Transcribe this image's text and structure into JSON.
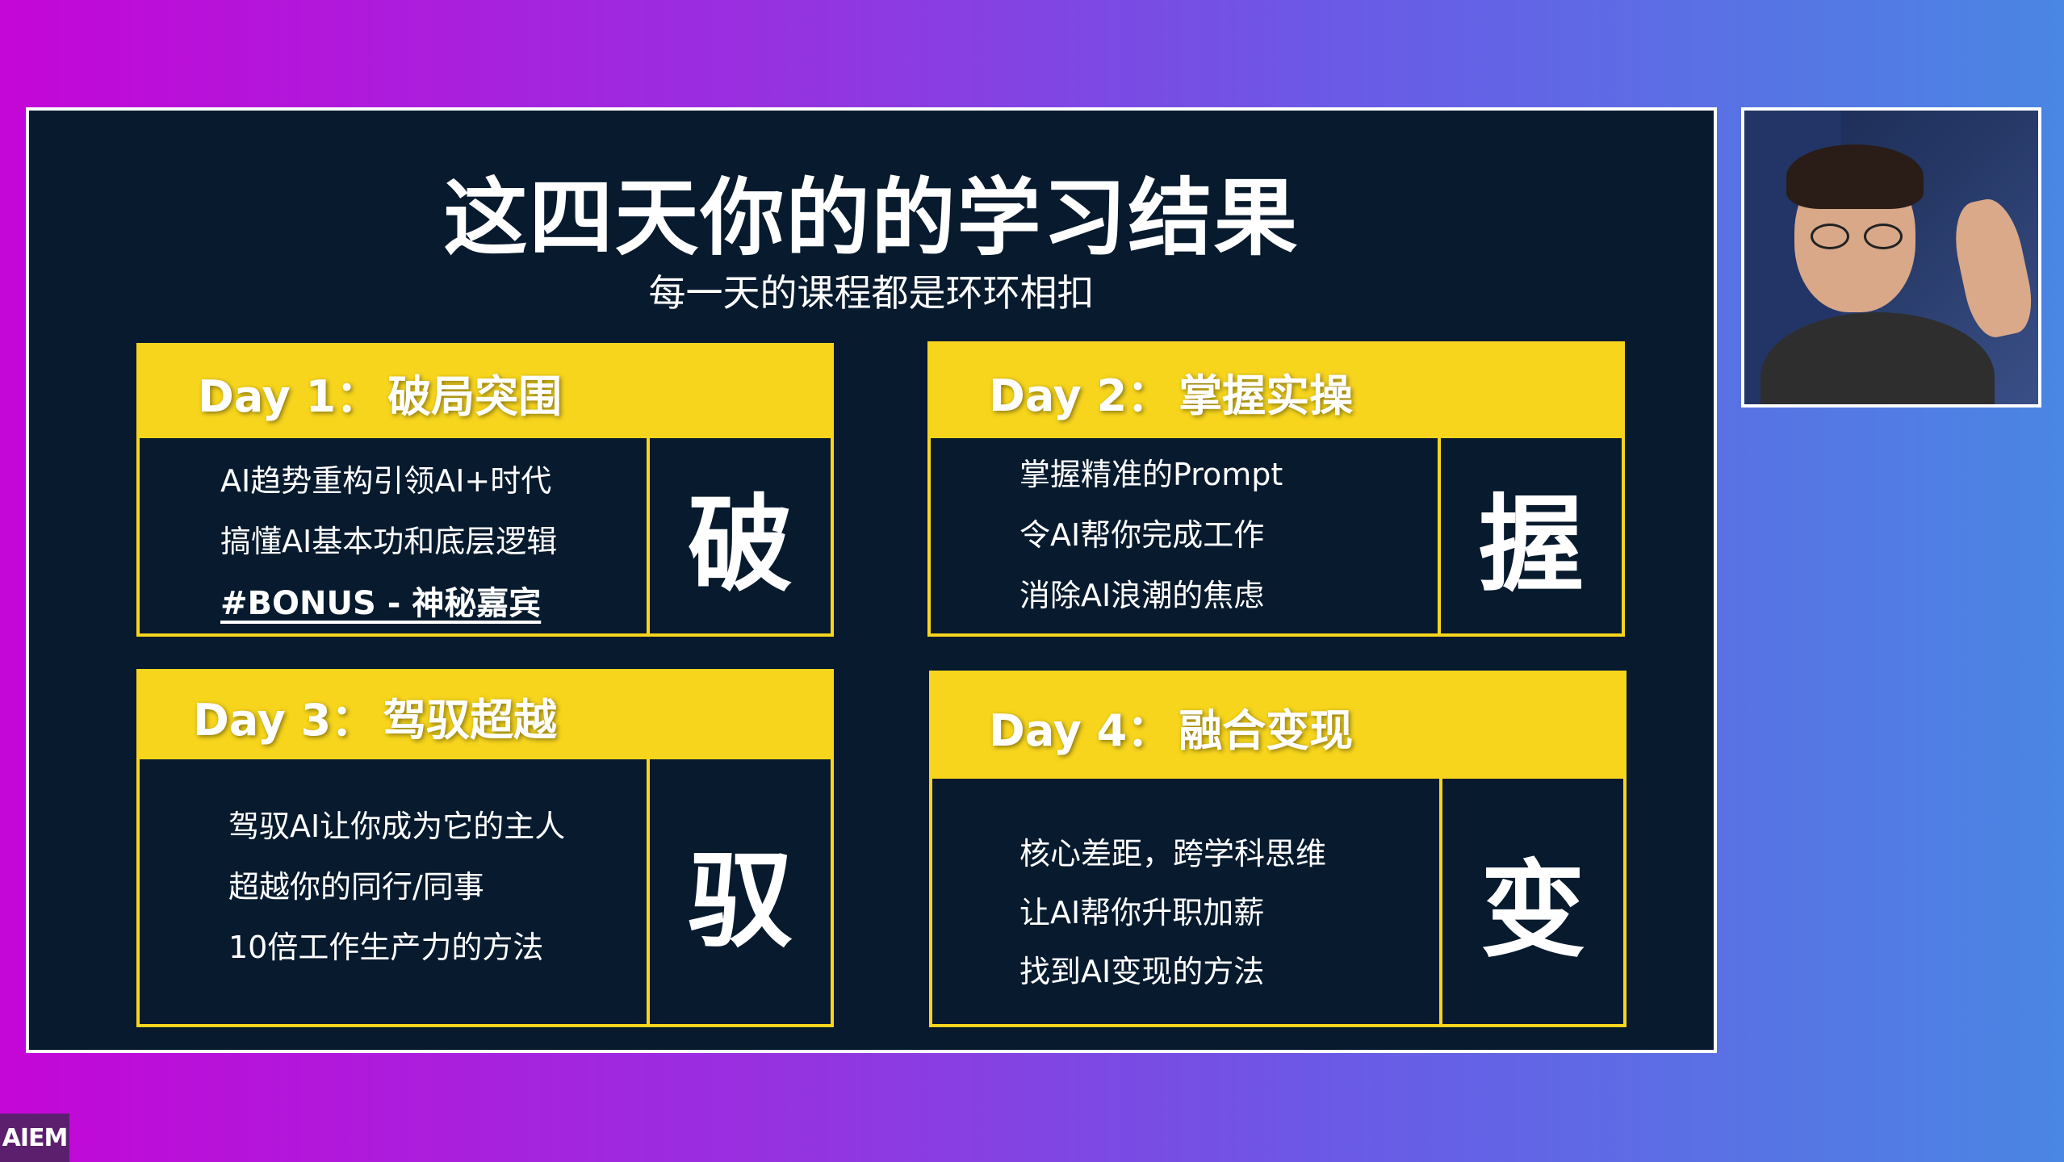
{
  "slide": {
    "title": "这四天你的的学习结果",
    "subtitle": "每一天的课程都是环环相扣"
  },
  "cards": [
    {
      "day": "Day 1：",
      "theme": "破局突围",
      "lines": [
        "AI趋势重构引领AI+时代",
        "搞懂AI基本功和底层逻辑",
        "#BONUS - 神秘嘉宾"
      ],
      "char": "破"
    },
    {
      "day": "Day 2：",
      "theme": "掌握实操",
      "lines": [
        "掌握精准的Prompt",
        "令AI帮你完成工作",
        "消除AI浪潮的焦虑"
      ],
      "char": "握"
    },
    {
      "day": "Day 3：",
      "theme": "驾驭超越",
      "lines": [
        "驾驭AI让你成为它的主人",
        "超越你的同行/同事",
        "10倍工作生产力的方法"
      ],
      "char": "驭"
    },
    {
      "day": "Day 4：",
      "theme": "融合变现",
      "lines": [
        "核心差距，跨学科思维",
        "让AI帮你升职加薪",
        "找到AI变现的方法"
      ],
      "char": "变"
    }
  ],
  "badge": {
    "label": "AIEM"
  },
  "colors": {
    "accent_yellow": "#f7d51d",
    "slide_background": "#071a2e"
  }
}
